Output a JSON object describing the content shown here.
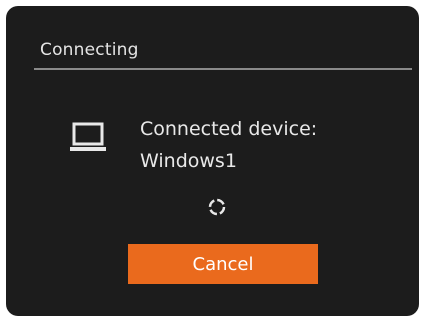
{
  "dialog": {
    "title": "Connecting",
    "device_label": "Connected device:",
    "device_name": "Windows1",
    "cancel_label": "Cancel"
  },
  "icons": {
    "device": "laptop-icon",
    "progress": "spinner-icon"
  },
  "colors": {
    "background": "#1c1c1c",
    "text": "#e8e8e8",
    "accent": "#ea6a1d",
    "divider": "#8a8a8a"
  }
}
